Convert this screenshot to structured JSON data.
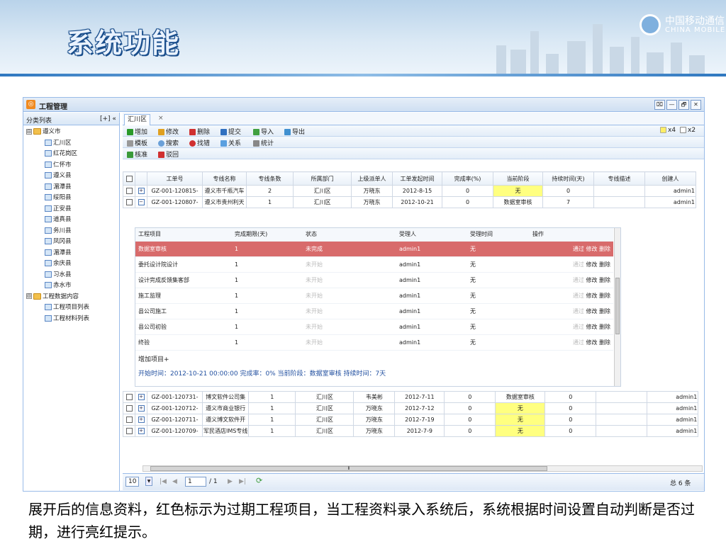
{
  "slide": {
    "title": "系统功能",
    "logo_cn": "中国移动通信",
    "logo_en": "CHINA MOBILE",
    "caption": "展开后的信息资料，红色标示为过期工程项目，当工程资料录入系统后，系统根据时间设置自动判断是否过期，进行亮红提示。"
  },
  "window": {
    "title": "工程管理",
    "btn_restore": "⌧",
    "btn_min": "—",
    "btn_max": "🗗",
    "btn_close": "✕"
  },
  "left": {
    "header": "分类列表",
    "header_tools": "[+] «"
  },
  "tree": [
    {
      "label": "遵义市",
      "level": 0,
      "type": "folder",
      "toggle": "⊟"
    },
    {
      "label": "汇川区",
      "level": 1,
      "type": "page"
    },
    {
      "label": "红花岗区",
      "level": 1,
      "type": "page"
    },
    {
      "label": "仁怀市",
      "level": 1,
      "type": "page"
    },
    {
      "label": "遵义县",
      "level": 1,
      "type": "page"
    },
    {
      "label": "湄潭县",
      "level": 1,
      "type": "page"
    },
    {
      "label": "绥阳县",
      "level": 1,
      "type": "page"
    },
    {
      "label": "正安县",
      "level": 1,
      "type": "page"
    },
    {
      "label": "道真县",
      "level": 1,
      "type": "page"
    },
    {
      "label": "务川县",
      "level": 1,
      "type": "page"
    },
    {
      "label": "凤冈县",
      "level": 1,
      "type": "page"
    },
    {
      "label": "湄潭县",
      "level": 1,
      "type": "page"
    },
    {
      "label": "余庆县",
      "level": 1,
      "type": "page"
    },
    {
      "label": "习水县",
      "level": 1,
      "type": "page"
    },
    {
      "label": "赤水市",
      "level": 1,
      "type": "page"
    },
    {
      "label": "工程数据内容",
      "level": 0,
      "type": "folder",
      "toggle": "⊟"
    },
    {
      "label": "工程项目列表",
      "level": 1,
      "type": "page"
    },
    {
      "label": "工程材料列表",
      "level": 1,
      "type": "page"
    }
  ],
  "tab": {
    "label": "汇川区",
    "close": "×"
  },
  "toolbar1": {
    "add": "增加",
    "edit": "修改",
    "delete": "删除",
    "submit": "提交",
    "import": "导入",
    "export": "导出",
    "x4": "x4",
    "x2": "x2"
  },
  "toolbar2": {
    "template": "模板",
    "search": "搜索",
    "find_error": "找错",
    "relation": "关系",
    "stats": "统计"
  },
  "toolbar3": {
    "approve": "核准",
    "reject": "驳回"
  },
  "columns": [
    "工单号",
    "专线名称",
    "专线条数",
    "所属部门",
    "上级派单人",
    "工单发起时间",
    "完成率(%)",
    "当前阶段",
    "持续时间(天)",
    "专线描述",
    "创建人"
  ],
  "rows_top": [
    {
      "toggle": "+",
      "id": "GZ-001-120815-",
      "name": "遵义市千瓶汽车",
      "count": "2",
      "dept": "汇川区",
      "dispatcher": "万晓东",
      "date": "2012-8-15",
      "rate": "0",
      "stage": "无",
      "days": "0",
      "desc": "",
      "creator": "admin1",
      "stage_highlight": true
    },
    {
      "toggle": "−",
      "id": "GZ-001-120807-",
      "name": "遵义市贵州利天",
      "count": "1",
      "dept": "汇川区",
      "dispatcher": "万晓东",
      "date": "2012-10-21",
      "rate": "0",
      "stage": "数据室审核",
      "days": "7",
      "desc": "",
      "creator": "admin1",
      "stage_highlight": false
    }
  ],
  "detail": {
    "headers": [
      "工程项目",
      "完成期限(天)",
      "状态",
      "受理人",
      "受理时间",
      "操作"
    ],
    "rows": [
      {
        "item": "数据室审核",
        "deadline": "1",
        "status": "未完成",
        "user": "admin1",
        "time": "无",
        "op1": "通过",
        "op2": "修改",
        "op3": "删除",
        "overdue": true
      },
      {
        "item": "委托设计院设计",
        "deadline": "1",
        "status": "未开始",
        "user": "admin1",
        "time": "无",
        "op1": "通过",
        "op2": "修改",
        "op3": "删除",
        "overdue": false
      },
      {
        "item": "设计完成反馈集客部",
        "deadline": "1",
        "status": "未开始",
        "user": "admin1",
        "time": "无",
        "op1": "通过",
        "op2": "修改",
        "op3": "删除",
        "overdue": false
      },
      {
        "item": "施工监理",
        "deadline": "1",
        "status": "未开始",
        "user": "admin1",
        "time": "无",
        "op1": "通过",
        "op2": "修改",
        "op3": "删除",
        "overdue": false
      },
      {
        "item": "县公司施工",
        "deadline": "1",
        "status": "未开始",
        "user": "admin1",
        "time": "无",
        "op1": "通过",
        "op2": "修改",
        "op3": "删除",
        "overdue": false
      },
      {
        "item": "县公司初验",
        "deadline": "1",
        "status": "未开始",
        "user": "admin1",
        "time": "无",
        "op1": "通过",
        "op2": "修改",
        "op3": "删除",
        "overdue": false
      },
      {
        "item": "终验",
        "deadline": "1",
        "status": "未开始",
        "user": "admin1",
        "time": "无",
        "op1": "通过",
        "op2": "修改",
        "op3": "删除",
        "overdue": false
      }
    ],
    "add_item": "增加项目+",
    "summary": "开始时间：2012-10-21 00:00:00  完成率：0%  当前阶段：数据室审核  持续时间：7天"
  },
  "rows_bottom": [
    {
      "toggle": "+",
      "id": "GZ-001-120731-",
      "name": "博文软件公司集",
      "count": "1",
      "dept": "汇川区",
      "dispatcher": "韦美彬",
      "date": "2012-7-11",
      "rate": "0",
      "stage": "数据室审核",
      "days": "0",
      "desc": "",
      "creator": "admin1",
      "stage_highlight": false
    },
    {
      "toggle": "+",
      "id": "GZ-001-120712-",
      "name": "遵义市商业银行",
      "count": "1",
      "dept": "汇川区",
      "dispatcher": "万晓东",
      "date": "2012-7-12",
      "rate": "0",
      "stage": "无",
      "days": "0",
      "desc": "",
      "creator": "admin1",
      "stage_highlight": true
    },
    {
      "toggle": "+",
      "id": "GZ-001-120711-",
      "name": "遵义博文软件开",
      "count": "1",
      "dept": "汇川区",
      "dispatcher": "万晓东",
      "date": "2012-7-19",
      "rate": "0",
      "stage": "无",
      "days": "0",
      "desc": "",
      "creator": "admin1",
      "stage_highlight": true
    },
    {
      "toggle": "+",
      "id": "GZ-001-120709-",
      "name": "军民酒店IMS专线",
      "count": "1",
      "dept": "汇川区",
      "dispatcher": "万晓东",
      "date": "2012-7-9",
      "rate": "0",
      "stage": "无",
      "days": "0",
      "desc": "",
      "creator": "admin1",
      "stage_highlight": true
    }
  ],
  "pager": {
    "page_size": "10",
    "page": "1",
    "total_pages": "/ 1",
    "total": "总 6 条",
    "scroll_mark": "⦀"
  },
  "colors": {
    "overdue_red": "#d86b6b",
    "highlight_yellow": "#ffff80",
    "accent_blue": "#99bbe8"
  }
}
